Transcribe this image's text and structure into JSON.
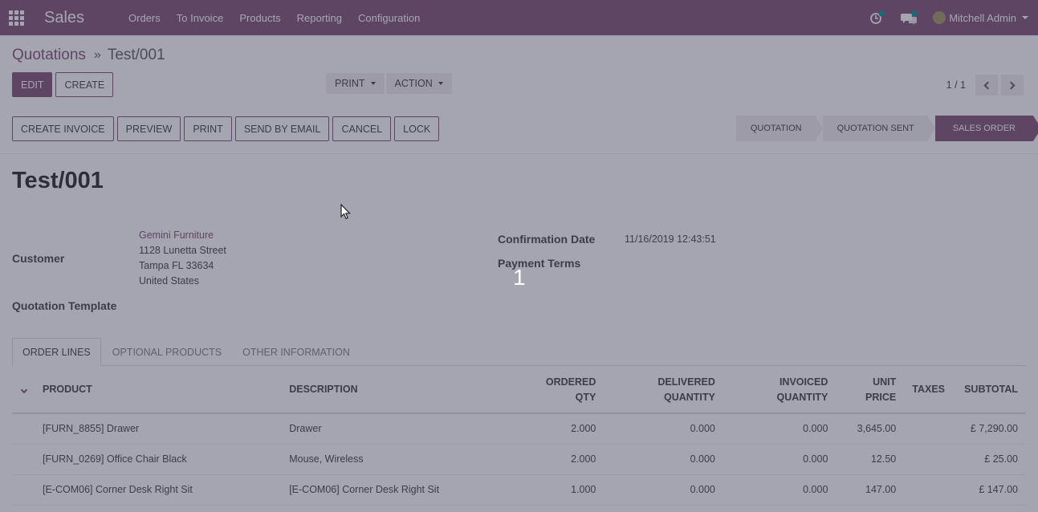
{
  "navbar": {
    "app_title": "Sales",
    "menu": [
      "Orders",
      "To Invoice",
      "Products",
      "Reporting",
      "Configuration"
    ],
    "user_name": "Mitchell Admin"
  },
  "control_panel": {
    "breadcrumb_parent": "Quotations",
    "breadcrumb_separator": "»",
    "breadcrumb_current": "Test/001",
    "edit_label": "EDIT",
    "create_label": "CREATE",
    "print_label": "PRINT",
    "action_label": "ACTION",
    "pager_value": "1 / 1"
  },
  "header": {
    "actions": [
      "CREATE INVOICE",
      "PREVIEW",
      "PRINT",
      "SEND BY EMAIL",
      "CANCEL",
      "LOCK"
    ],
    "stages": [
      "QUOTATION",
      "QUOTATION SENT",
      "SALES ORDER"
    ],
    "active_stage": "SALES ORDER"
  },
  "form": {
    "title": "Test/001",
    "customer_label": "Customer",
    "customer_name": "Gemini Furniture",
    "customer_street": "1128 Lunetta Street",
    "customer_city": "Tampa FL 33634",
    "customer_country": "United States",
    "template_label": "Quotation Template",
    "confirmation_date_label": "Confirmation Date",
    "confirmation_date": "11/16/2019 12:43:51",
    "payment_terms_label": "Payment Terms"
  },
  "overlay": {
    "step_number": "1"
  },
  "tabs": [
    "ORDER LINES",
    "OPTIONAL PRODUCTS",
    "OTHER INFORMATION"
  ],
  "order_lines": {
    "headers": {
      "product": "PRODUCT",
      "description": "DESCRIPTION",
      "ordered_qty_1": "ORDERED",
      "ordered_qty_2": "QTY",
      "delivered_1": "DELIVERED",
      "delivered_2": "QUANTITY",
      "invoiced_1": "INVOICED",
      "invoiced_2": "QUANTITY",
      "unit_price_1": "UNIT",
      "unit_price_2": "PRICE",
      "taxes": "TAXES",
      "subtotal": "SUBTOTAL"
    },
    "rows": [
      {
        "product": "[FURN_8855] Drawer",
        "description": "Drawer",
        "ordered": "2.000",
        "delivered": "0.000",
        "invoiced": "0.000",
        "unit_price": "3,645.00",
        "taxes": "",
        "subtotal": "£ 7,290.00"
      },
      {
        "product": "[FURN_0269] Office Chair Black",
        "description": "Mouse, Wireless",
        "ordered": "2.000",
        "delivered": "0.000",
        "invoiced": "0.000",
        "unit_price": "12.50",
        "taxes": "",
        "subtotal": "£ 25.00"
      },
      {
        "product": "[E-COM06] Corner Desk Right Sit",
        "description": "[E-COM06] Corner Desk Right Sit",
        "ordered": "1.000",
        "delivered": "0.000",
        "invoiced": "0.000",
        "unit_price": "147.00",
        "taxes": "",
        "subtotal": "£ 147.00"
      }
    ]
  },
  "colors": {
    "brand": "#875a7b",
    "overlay": "rgba(40,40,70,0.42)"
  },
  "icons": [
    "apps-grid-icon",
    "activity-clock-icon",
    "discuss-chat-icon",
    "chevron-left-icon",
    "chevron-right-icon",
    "chevron-down-icon",
    "mouse-cursor-icon"
  ]
}
